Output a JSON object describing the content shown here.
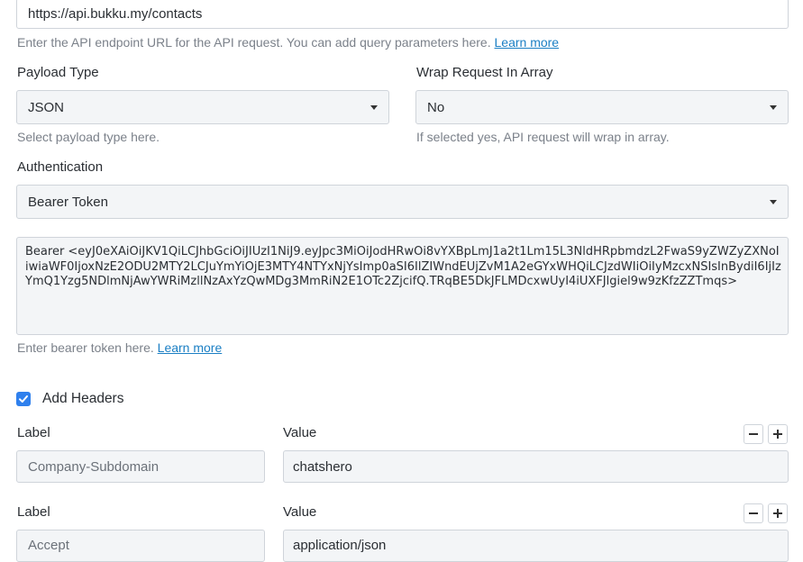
{
  "endpoint": {
    "value": "https://api.bukku.my/contacts",
    "help_text": "Enter the API endpoint URL for the API request. You can add query parameters here.",
    "help_link": "Learn more"
  },
  "payload_type": {
    "label": "Payload Type",
    "value": "JSON",
    "help": "Select payload type here."
  },
  "wrap_request": {
    "label": "Wrap Request In Array",
    "value": "No",
    "help": "If selected yes, API request will wrap in array."
  },
  "authentication": {
    "label": "Authentication",
    "value": "Bearer Token"
  },
  "bearer": {
    "value": "Bearer <eyJ0eXAiOiJKV1QiLCJhbGciOiJIUzI1NiJ9.eyJpc3MiOiJodHRwOi8vYXBpLmJ1a2t1Lm15L3NldHRpbmdzL2FwaS9yZWZyZXNoIiwiaWF0IjoxNzE2ODU2MTY2LCJuYmYiOjE3MTY4NTYxNjYsImp0aSI6IlZIWndEUjZvM1A2eGYxWHQiLCJzdWIiOiIyMzcxNSIsInBydiI6IjIzYmQ1Yzg5NDlmNjAwYWRiMzllNzAxYzQwMDg3MmRiN2E1OTc2ZjcifQ.TRqBE5DkJFLMDcxwUyI4iUXFJlgiel9w9zKfzZZTmqs>",
    "help_text": "Enter bearer token here.",
    "help_link": "Learn more"
  },
  "headers": {
    "checkbox_label": "Add Headers",
    "checked": true,
    "rows": [
      {
        "label_title": "Label",
        "value_title": "Value",
        "label": "Company-Subdomain",
        "value": "chatshero"
      },
      {
        "label_title": "Label",
        "value_title": "Value",
        "label": "Accept",
        "value": "application/json"
      }
    ]
  }
}
